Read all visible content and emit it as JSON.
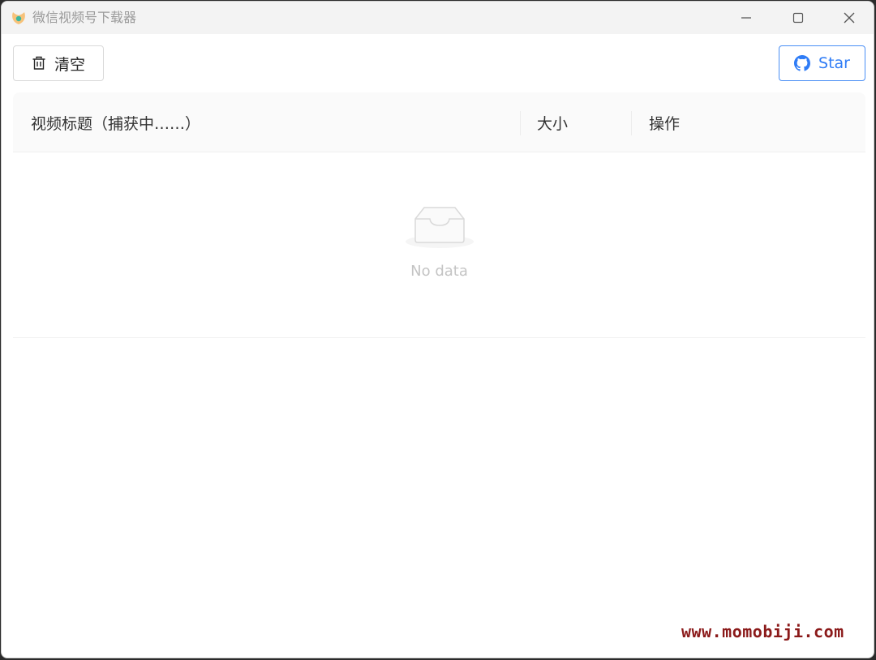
{
  "window": {
    "title": "微信视频号下载器"
  },
  "toolbar": {
    "clear_label": "清空",
    "clear_icon": "trash-icon",
    "star_label": "Star",
    "star_icon": "github-icon"
  },
  "table": {
    "columns": [
      {
        "label": "视频标题（捕获中……）"
      },
      {
        "label": "大小"
      },
      {
        "label": "操作"
      }
    ],
    "rows": [],
    "empty_text": "No data"
  },
  "watermark": "www.momobiji.com",
  "colors": {
    "accent": "#2f7cf6",
    "titlebar": "#f3f3f3",
    "header_bg": "#fafafa",
    "empty_text": "#c4c4c4"
  }
}
